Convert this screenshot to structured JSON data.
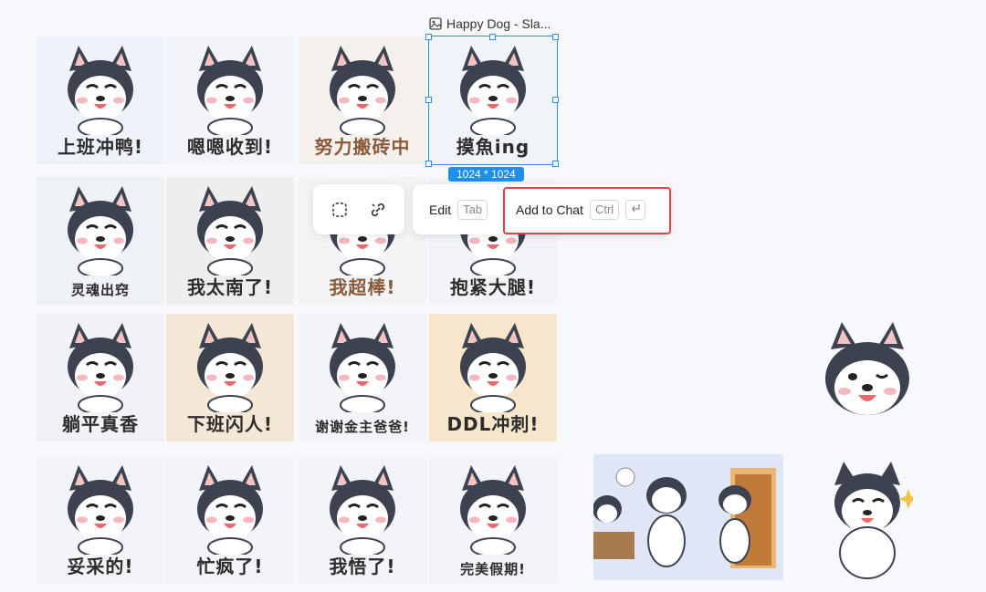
{
  "file": {
    "title": "Happy Dog - Sla...",
    "size_badge": "1024 * 1024"
  },
  "toolbar": {
    "edit_label": "Edit",
    "edit_key": "Tab",
    "add_to_chat_label": "Add to Chat",
    "add_to_chat_key": "Ctrl",
    "enter_icon": "enter-key-icon",
    "select_icon": "dashed-select-icon",
    "link_icon": "chain-link-icon"
  },
  "stickers": [
    {
      "caption": "上班冲鸭!"
    },
    {
      "caption": "嗯嗯收到!"
    },
    {
      "caption": "努力搬砖中"
    },
    {
      "caption": "摸魚ing"
    },
    {
      "caption": "灵魂出窍"
    },
    {
      "caption": "我太南了!"
    },
    {
      "caption": "我超棒!"
    },
    {
      "caption": "抱紧大腿!"
    },
    {
      "caption": "躺平真香"
    },
    {
      "caption": "下班闪人!"
    },
    {
      "caption": "谢谢金主爸爸!"
    },
    {
      "caption": "DDL冲刺!"
    },
    {
      "caption": "妥采的!"
    },
    {
      "caption": "忙疯了!"
    },
    {
      "caption": "我悟了!"
    },
    {
      "caption": "完美假期!"
    }
  ],
  "colors": {
    "accent": "#2d8cf0",
    "highlight": "#e04444",
    "badge": "#1e8ff0"
  }
}
